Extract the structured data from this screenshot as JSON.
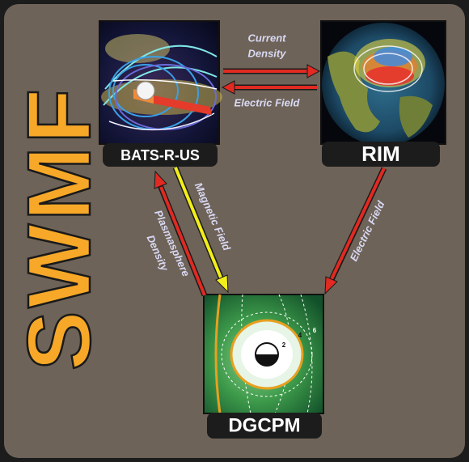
{
  "title": "SWMF",
  "colors": {
    "background": "#6e6358",
    "frame": "#1c1c1c",
    "title_fill": "#f7a828",
    "label_text": "#d9d9f4",
    "arrow_red": "#e02a22",
    "arrow_yellow": "#f2ee1a"
  },
  "components": [
    {
      "id": "bats",
      "label": "BATS-R-US"
    },
    {
      "id": "rim",
      "label": "RIM"
    },
    {
      "id": "dgcpm",
      "label": "DGCPM"
    }
  ],
  "links": {
    "current_density": {
      "line1": "Current",
      "line2": "Density"
    },
    "electric_field_rim_bats": "Electric Field",
    "magnetic_field": "Magnetic Field",
    "plasmasphere_density": {
      "line1": "Plasmasphere",
      "line2": "Density"
    },
    "electric_field_rim_dgcpm": "Electric Field"
  },
  "dgcpm_contour_labels": [
    "2",
    "4",
    "6"
  ]
}
